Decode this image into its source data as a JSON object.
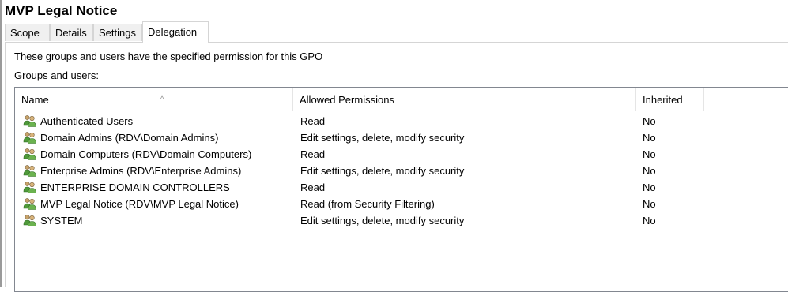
{
  "title": "MVP Legal Notice",
  "tabs": [
    {
      "label": "Scope"
    },
    {
      "label": "Details"
    },
    {
      "label": "Settings"
    },
    {
      "label": "Delegation"
    }
  ],
  "active_tab": "Delegation",
  "description": "These groups and users have the specified permission for this GPO",
  "groups_label": "Groups and users:",
  "columns": {
    "name": "Name",
    "permissions": "Allowed Permissions",
    "inherited": "Inherited"
  },
  "rows": [
    {
      "name": "Authenticated Users",
      "permissions": "Read",
      "inherited": "No",
      "icon": "user-group-icon"
    },
    {
      "name": "Domain Admins (RDV\\Domain Admins)",
      "permissions": "Edit settings, delete, modify security",
      "inherited": "No",
      "icon": "user-group-icon"
    },
    {
      "name": "Domain Computers (RDV\\Domain Computers)",
      "permissions": "Read",
      "inherited": "No",
      "icon": "user-group-icon"
    },
    {
      "name": "Enterprise Admins (RDV\\Enterprise Admins)",
      "permissions": "Edit settings, delete, modify security",
      "inherited": "No",
      "icon": "user-group-icon"
    },
    {
      "name": "ENTERPRISE DOMAIN CONTROLLERS",
      "permissions": "Read",
      "inherited": "No",
      "icon": "user-group-icon"
    },
    {
      "name": "MVP Legal Notice (RDV\\MVP Legal Notice)",
      "permissions": "Read (from Security Filtering)",
      "inherited": "No",
      "icon": "user-group-icon"
    },
    {
      "name": "SYSTEM",
      "permissions": "Edit settings, delete, modify security",
      "inherited": "No",
      "icon": "user-group-icon"
    }
  ],
  "colors": {
    "border": "#828790",
    "tab_bg": "#f0f0f0",
    "icon_green": "#4f9a3a",
    "icon_tan": "#c9a36a"
  }
}
